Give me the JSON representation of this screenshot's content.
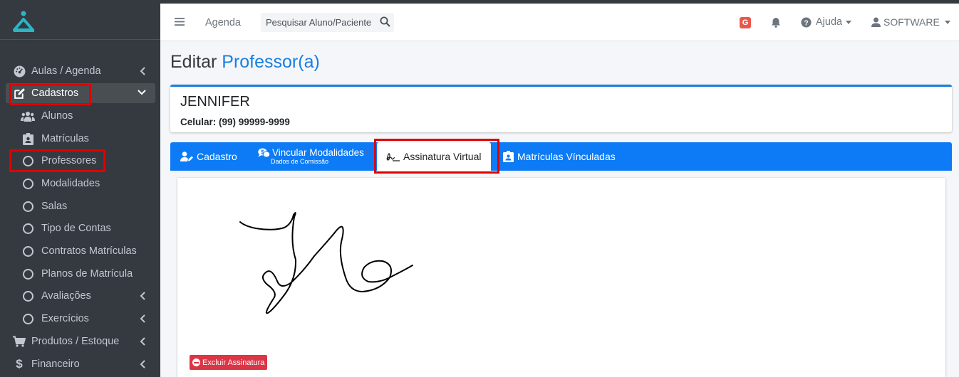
{
  "sidebar": {
    "items": [
      {
        "label": "Aulas / Agenda",
        "icon": "tachometer-icon"
      },
      {
        "label": "Cadastros",
        "icon": "edit-icon"
      },
      {
        "label": "Alunos",
        "icon": "users-icon"
      },
      {
        "label": "Matrículas",
        "icon": "id-badge-icon"
      },
      {
        "label": "Professores",
        "icon": "circle-icon"
      },
      {
        "label": "Modalidades",
        "icon": "circle-icon"
      },
      {
        "label": "Salas",
        "icon": "circle-icon"
      },
      {
        "label": "Tipo de Contas",
        "icon": "circle-icon"
      },
      {
        "label": "Contratos Matrículas",
        "icon": "circle-icon"
      },
      {
        "label": "Planos de Matrícula",
        "icon": "circle-icon"
      },
      {
        "label": "Avaliações",
        "icon": "circle-icon"
      },
      {
        "label": "Exercícios",
        "icon": "circle-icon"
      },
      {
        "label": "Produtos / Estoque",
        "icon": "cart-icon"
      },
      {
        "label": "Financeiro",
        "icon": "dollar-icon"
      }
    ]
  },
  "header": {
    "agenda_label": "Agenda",
    "search_placeholder": "Pesquisar Aluno/Paciente",
    "badge_letter": "G",
    "help_label": "Ajuda",
    "user_label": "SOFTWARE"
  },
  "page": {
    "title_prefix": "Editar",
    "title_accent": "Professor(a)"
  },
  "profile": {
    "name": "JENNIFER",
    "phone": "Celular: (99) 99999-9999"
  },
  "tabs": {
    "cadastro": "Cadastro",
    "vincular": "Vincular Modalidades",
    "vincular_sub": "Dados de Comissão",
    "vincular_required": "*",
    "assinatura": "Assinatura Virtual",
    "matriculas": "Matrículas Vínculadas"
  },
  "signature": {
    "delete_label": "Excluir Assinatura"
  },
  "colors": {
    "sidebar_bg": "#343a40",
    "primary": "#0d7bf5",
    "accent_text": "#1a7fe0",
    "danger": "#dc3545",
    "highlight": "#e00000"
  }
}
